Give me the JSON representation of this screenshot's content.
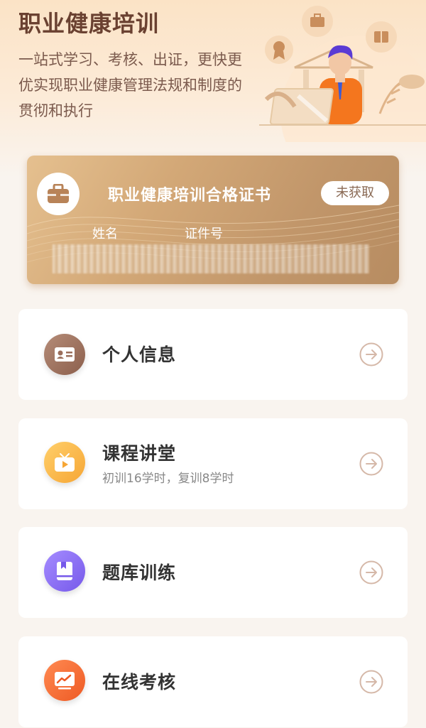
{
  "header": {
    "title": "职业健康培训",
    "description": "一站式学习、考核、出证，更快更优实现职业健康管理法规和制度的贯彻和执行"
  },
  "certificate": {
    "title": "职业健康培训合格证书",
    "status": "未获取",
    "name_label": "姓名",
    "id_label": "证件号"
  },
  "menu": [
    {
      "label": "个人信息",
      "subtitle": "",
      "icon": "id-card-icon",
      "color": "#9b6f5c"
    },
    {
      "label": "课程讲堂",
      "subtitle": "初训16学时，复训8学时",
      "icon": "tv-icon",
      "color": "#fbb444"
    },
    {
      "label": "题库训练",
      "subtitle": "",
      "icon": "book-icon",
      "color": "#8a6cf0"
    },
    {
      "label": "在线考核",
      "subtitle": "",
      "icon": "chart-icon",
      "color": "#f26b3a"
    }
  ],
  "colors": {
    "title": "#6a4131",
    "card_gold": "#c99d6c",
    "arrow": "#d5b8a8"
  }
}
